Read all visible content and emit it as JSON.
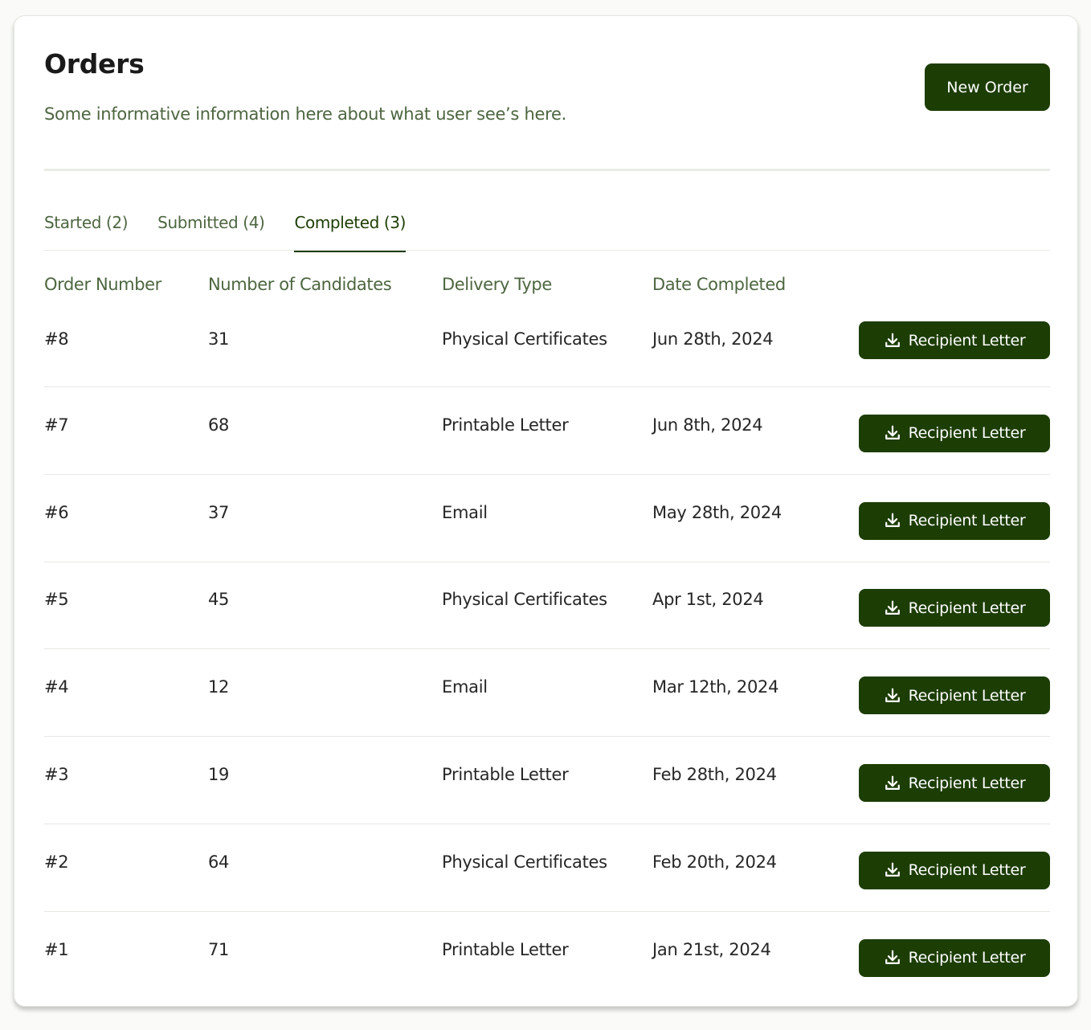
{
  "header": {
    "title": "Orders",
    "description": "Some informative information here about what user see’s here.",
    "new_order_label": "New Order"
  },
  "tabs": [
    {
      "label": "Started (2)",
      "active": false
    },
    {
      "label": "Submitted (4)",
      "active": false
    },
    {
      "label": "Completed (3)",
      "active": true
    }
  ],
  "table": {
    "columns": [
      "Order Number",
      "Number of Candidates",
      "Delivery Type",
      "Date Completed"
    ],
    "action_label": "Recipient Letter",
    "action_icon": "download-icon",
    "rows": [
      {
        "order": "#8",
        "candidates": "31",
        "delivery": "Physical Certificates",
        "date": "Jun 28th, 2024"
      },
      {
        "order": "#7",
        "candidates": "68",
        "delivery": "Printable Letter",
        "date": "Jun 8th, 2024"
      },
      {
        "order": "#6",
        "candidates": "37",
        "delivery": "Email",
        "date": "May 28th, 2024"
      },
      {
        "order": "#5",
        "candidates": "45",
        "delivery": "Physical Certificates",
        "date": "Apr 1st, 2024"
      },
      {
        "order": "#4",
        "candidates": "12",
        "delivery": "Email",
        "date": "Mar 12th, 2024"
      },
      {
        "order": "#3",
        "candidates": "19",
        "delivery": "Printable Letter",
        "date": "Feb 28th, 2024"
      },
      {
        "order": "#2",
        "candidates": "64",
        "delivery": "Physical Certificates",
        "date": "Feb 20th, 2024"
      },
      {
        "order": "#1",
        "candidates": "71",
        "delivery": "Printable Letter",
        "date": "Jan 21st, 2024"
      }
    ]
  },
  "colors": {
    "primary": "#1c3d04",
    "muted_text": "#4d6640",
    "body_text": "#262626"
  }
}
